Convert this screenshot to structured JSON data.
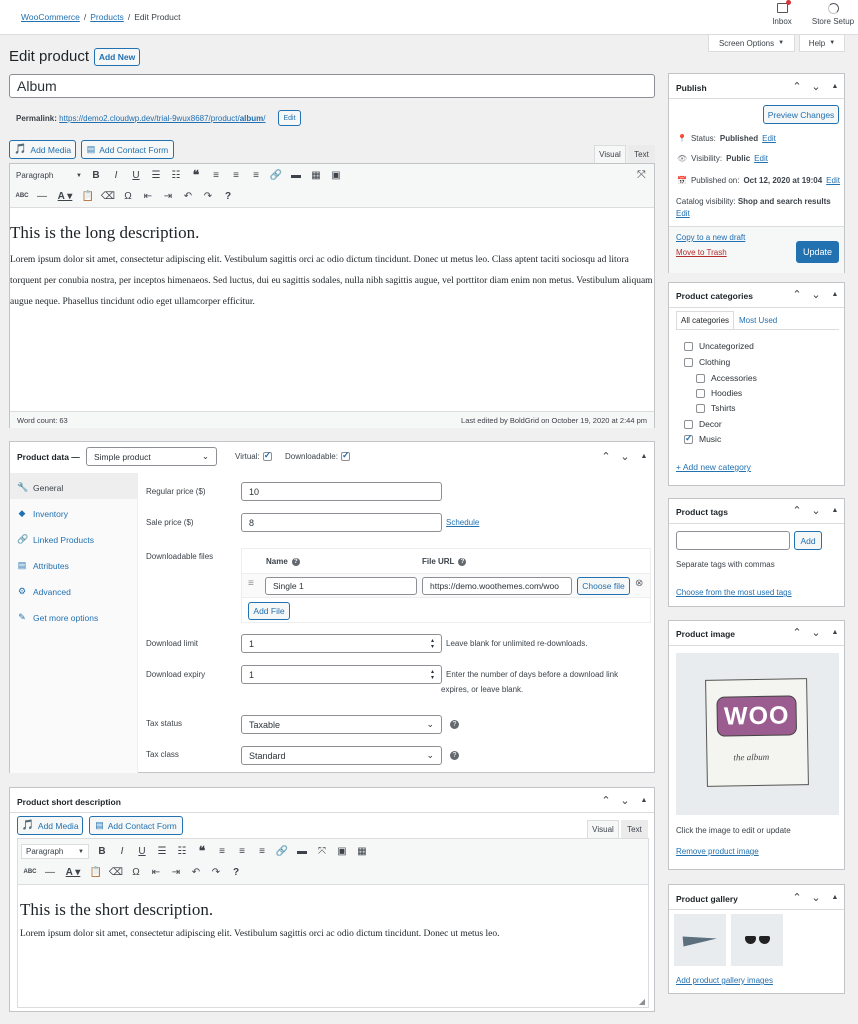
{
  "topbar": {
    "breadcrumb": {
      "woocommerce": "WooCommerce",
      "sep1": "/",
      "products": "Products",
      "sep2": "/",
      "current": "Edit Product"
    },
    "inbox_label": "Inbox",
    "store_setup_label": "Store Setup",
    "screen_options_label": "Screen Options",
    "help_label": "Help"
  },
  "header": {
    "title": "Edit product",
    "add_new_label": "Add New"
  },
  "post": {
    "title_value": "Album",
    "permalink_label": "Permalink:",
    "permalink_prefix": "https://demo2.cloudwp.dev/trial-9wux8687/product/",
    "permalink_slug": "album",
    "permalink_suffix": "/",
    "edit_label": "Edit"
  },
  "editor": {
    "add_media_label": "Add Media",
    "add_contact_form_label": "Add Contact Form",
    "visual_tab": "Visual",
    "text_tab": "Text",
    "format_select": "Paragraph",
    "heading": "This is the long description.",
    "body": "Lorem ipsum dolor sit amet, consectetur adipiscing elit. Vestibulum sagittis orci ac odio dictum tincidunt. Donec ut metus leo. Class aptent taciti sociosqu ad litora torquent per conubia nostra, per inceptos himenaeos. Sed luctus, dui eu sagittis sodales, nulla nibh sagittis augue, vel porttitor diam enim non metus. Vestibulum aliquam augue neque. Phasellus tincidunt odio eget ullamcorper efficitur.",
    "word_count": "Word count: 63",
    "last_edited": "Last edited by BoldGrid on October 19, 2020 at 2:44 pm"
  },
  "product_data": {
    "title": "Product data —",
    "type_select": "Simple product",
    "virtual_label": "Virtual:",
    "downloadable_label": "Downloadable:",
    "tabs": [
      {
        "label": "General"
      },
      {
        "label": "Inventory"
      },
      {
        "label": "Linked Products"
      },
      {
        "label": "Attributes"
      },
      {
        "label": "Advanced"
      },
      {
        "label": "Get more options"
      }
    ],
    "regular_price_label": "Regular price ($)",
    "regular_price_value": "10",
    "sale_price_label": "Sale price ($)",
    "sale_price_value": "8",
    "schedule_label": "Schedule",
    "downloadable_files_label": "Downloadable files",
    "files_name_header": "Name",
    "files_url_header": "File URL",
    "file_name_value": "Single 1",
    "file_url_value": "https://demo.woothemes.com/woo",
    "choose_file_label": "Choose file",
    "add_file_label": "Add File",
    "download_limit_label": "Download limit",
    "download_limit_value": "1",
    "download_limit_hint": "Leave blank for unlimited re-downloads.",
    "download_expiry_label": "Download expiry",
    "download_expiry_value": "1",
    "download_expiry_hint1": "Enter the number of days before a download link",
    "download_expiry_hint2": "expires, or leave blank.",
    "tax_status_label": "Tax status",
    "tax_status_value": "Taxable",
    "tax_class_label": "Tax class",
    "tax_class_value": "Standard"
  },
  "short_desc": {
    "title": "Product short description",
    "add_media_label": "Add Media",
    "add_contact_form_label": "Add Contact Form",
    "visual_tab": "Visual",
    "text_tab": "Text",
    "format_select": "Paragraph",
    "heading": "This is the short description.",
    "body": "Lorem ipsum dolor sit amet, consectetur adipiscing elit. Vestibulum sagittis orci ac odio dictum tincidunt. Donec ut metus leo."
  },
  "publish": {
    "title": "Publish",
    "preview_label": "Preview Changes",
    "status_label": "Status:",
    "status_value": "Published",
    "visibility_label": "Visibility:",
    "visibility_value": "Public",
    "published_on_label": "Published on:",
    "published_on_value": "Oct 12, 2020 at 19:04",
    "catalog_label": "Catalog visibility:",
    "catalog_value": "Shop and search results",
    "edit_label": "Edit",
    "copy_draft_label": "Copy to a new draft",
    "trash_label": "Move to Trash",
    "update_label": "Update"
  },
  "categories": {
    "title": "Product categories",
    "tab_all": "All categories",
    "tab_most_used": "Most Used",
    "items": [
      {
        "label": "Uncategorized",
        "checked": false
      },
      {
        "label": "Clothing",
        "checked": false
      },
      {
        "label": "Accessories",
        "checked": false
      },
      {
        "label": "Hoodies",
        "checked": false
      },
      {
        "label": "Tshirts",
        "checked": false
      },
      {
        "label": "Decor",
        "checked": false
      },
      {
        "label": "Music",
        "checked": true
      }
    ],
    "add_new_label": "+ Add new category"
  },
  "tags": {
    "title": "Product tags",
    "add_label": "Add",
    "hint": "Separate tags with commas",
    "choose_label": "Choose from the most used tags"
  },
  "image": {
    "title": "Product image",
    "logo_text": "WOO",
    "album_text": "the album",
    "hint": "Click the image to edit or update",
    "remove_label": "Remove product image"
  },
  "gallery": {
    "title": "Product gallery",
    "add_label": "Add product gallery images"
  },
  "colors": {
    "accent": "#2271b1",
    "danger": "#b32d2e",
    "border": "#c3c4c7",
    "bg": "#f0f0f1"
  }
}
